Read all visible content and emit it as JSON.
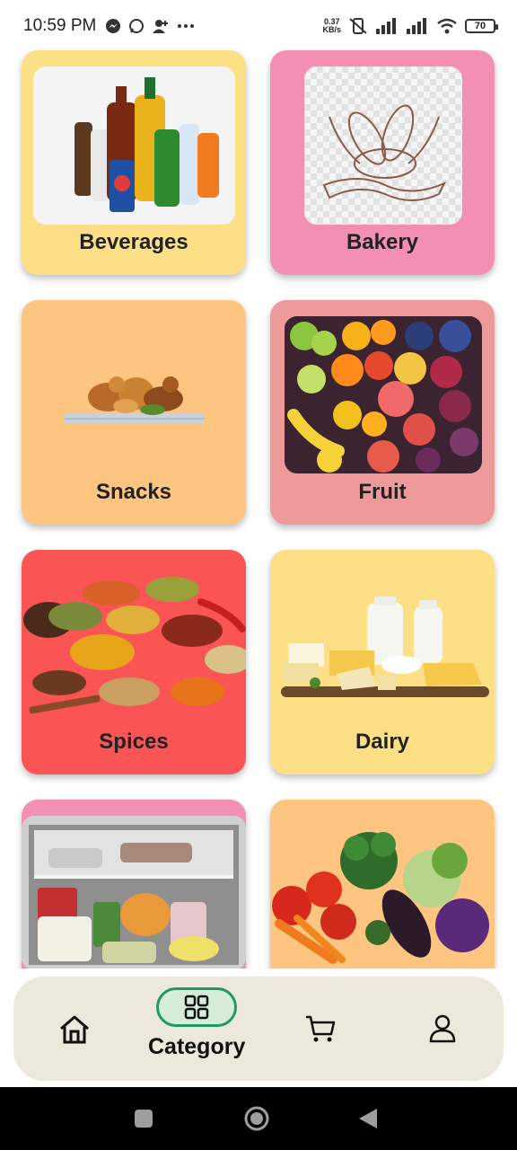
{
  "status_bar": {
    "time": "10:59 PM",
    "net_speed_value": "0.37",
    "net_speed_unit": "KB/s",
    "battery": "70",
    "icons": [
      "messenger-icon",
      "whatsapp-icon",
      "add-user-icon",
      "more-icon",
      "vibrate-off-icon",
      "signal-icon",
      "signal-icon",
      "wifi-icon",
      "battery-icon"
    ]
  },
  "categories": [
    {
      "label": "Beverages",
      "bg": "#fddf86"
    },
    {
      "label": "Bakery",
      "bg": "#f28fb3"
    },
    {
      "label": "Snacks",
      "bg": "#fdc57f"
    },
    {
      "label": "Fruit",
      "bg": "#ef9a9a"
    },
    {
      "label": "Spices",
      "bg": "#fb5454"
    },
    {
      "label": "Dairy",
      "bg": "#fddf86"
    },
    {
      "label": "",
      "bg": "#f28fb3"
    },
    {
      "label": "",
      "bg": "#fdc57f"
    }
  ],
  "bottom_nav": {
    "items": [
      {
        "icon": "home-icon"
      },
      {
        "icon": "category-grid-icon",
        "label": "Category",
        "active": true
      },
      {
        "icon": "cart-icon"
      },
      {
        "icon": "profile-icon"
      }
    ],
    "active_color": "#1f9a64"
  },
  "system_nav": {
    "icons": [
      "recents-icon",
      "home-circle-icon",
      "back-icon"
    ]
  }
}
